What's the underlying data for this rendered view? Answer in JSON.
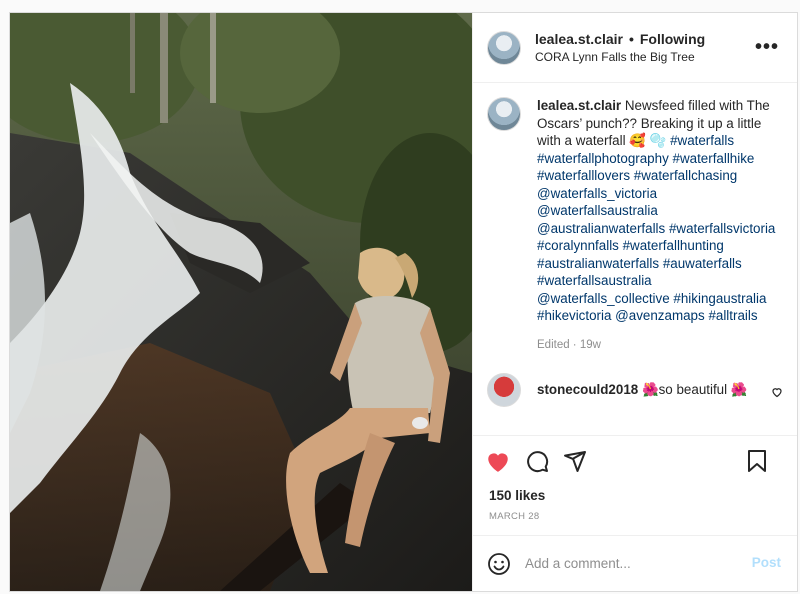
{
  "header": {
    "username": "lealea.st.clair",
    "separator": "•",
    "follow_status": "Following",
    "location": "CORA Lynn Falls the Big Tree",
    "more_glyph": "•••"
  },
  "caption": {
    "username": "lealea.st.clair",
    "text": " Newsfeed filled with The Oscars’ punch?? Breaking it up a little with a waterfall 🥰 🫧 ",
    "hashtags": [
      "#waterfalls",
      "#waterfallphotography",
      "#waterfallhike",
      "#waterfalllovers",
      "#waterfallchasing",
      "@waterfalls_victoria",
      "@waterfallsaustralia",
      "@australianwaterfalls",
      "#waterfallsvictoria",
      "#coralynnfalls",
      "#waterfallhunting",
      "#australianwaterfalls",
      "#auwaterfalls",
      "#waterfallsaustralia",
      "@waterfalls_collective",
      "#hikingaustralia",
      "#hikevictoria",
      "@avenzamaps",
      "#alltrails"
    ],
    "edited": "Edited · 19w"
  },
  "comments": [
    {
      "username": "stonecould2018",
      "text": " 🌺so beautiful 🌺"
    }
  ],
  "actions": {
    "like_icon": "heart-filled-icon",
    "comment_icon": "comment-icon",
    "share_icon": "share-icon",
    "save_icon": "bookmark-icon",
    "like_color": "#ed4956"
  },
  "likes": "150 likes",
  "date": "MARCH 28",
  "add_comment": {
    "placeholder": "Add a comment...",
    "post_label": "Post",
    "emoji_icon": "smiley-icon"
  }
}
